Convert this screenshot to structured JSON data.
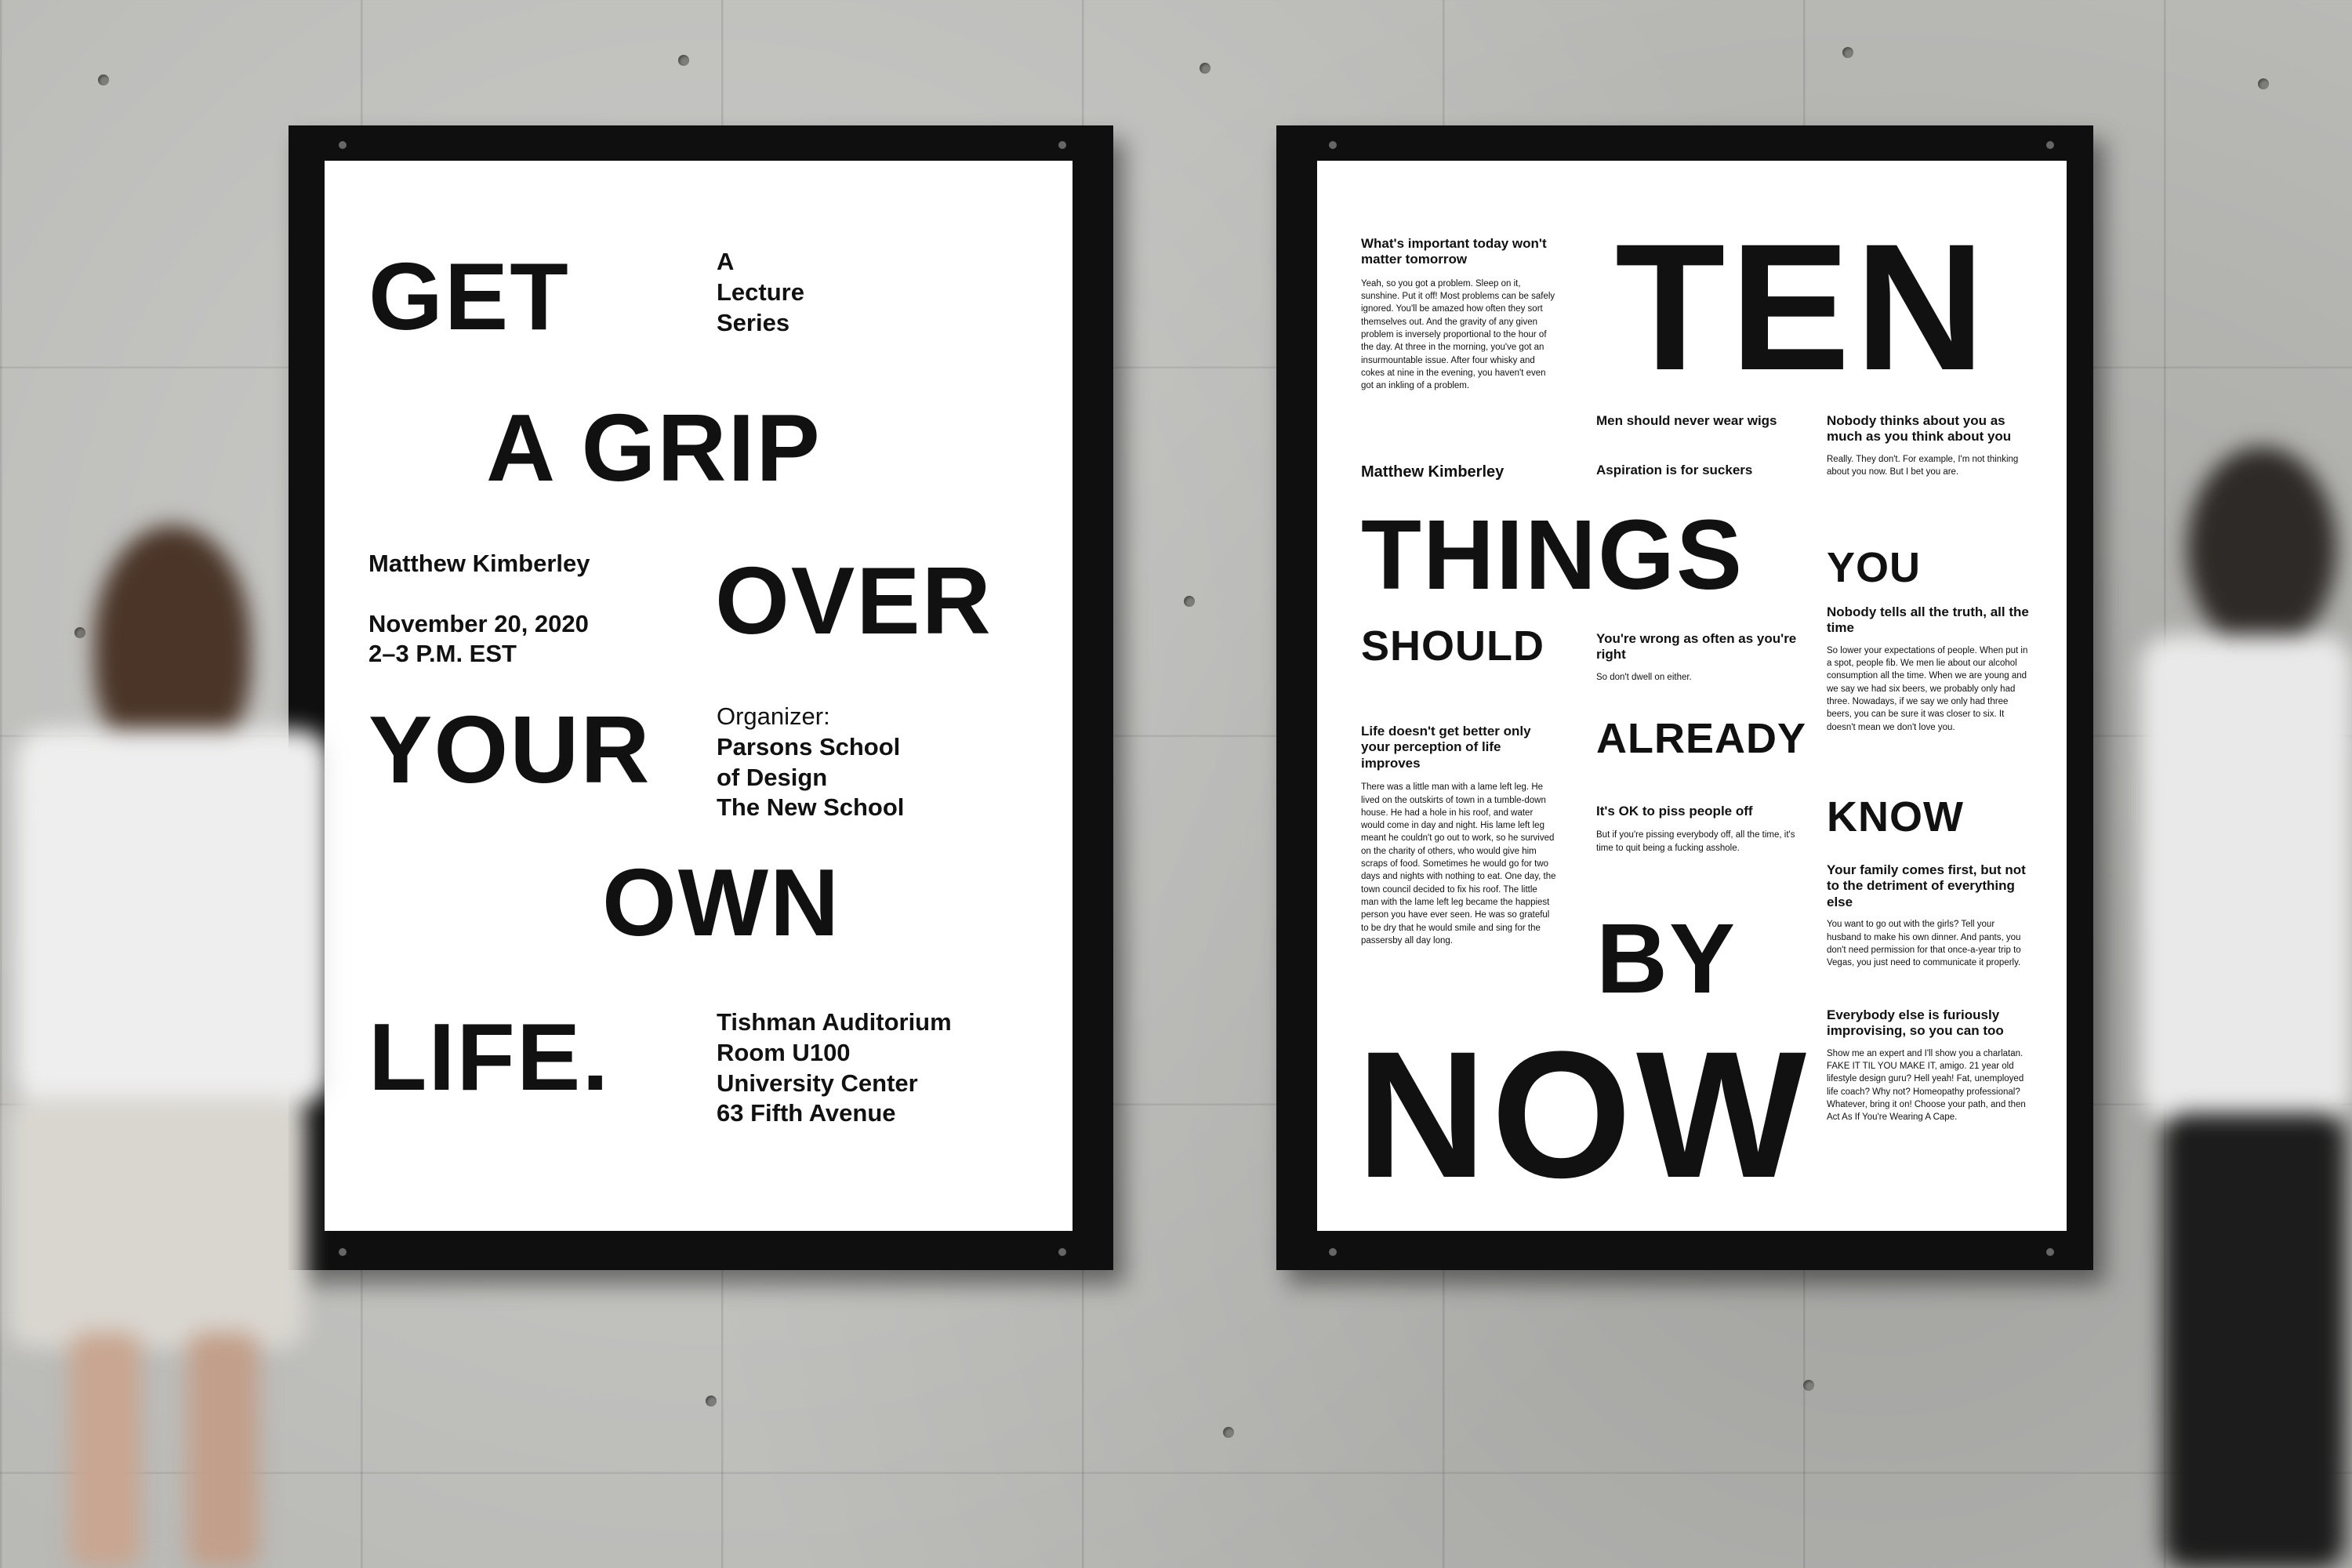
{
  "left_poster": {
    "title_lines": [
      "GET",
      "A GRIP",
      "OVER",
      "YOUR",
      "OWN",
      "LIFE."
    ],
    "series": [
      "A",
      "Lecture",
      "Series"
    ],
    "speaker": "Matthew Kimberley",
    "date": "November 20, 2020",
    "time": "2–3 P.M. EST",
    "organizer_label": "Organizer:",
    "organizer_lines": [
      "Parsons School",
      "of Design",
      "The New School"
    ],
    "venue_lines": [
      "Tishman Auditorium",
      "Room U100",
      "University Center",
      "63 Fifth Avenue"
    ]
  },
  "right_poster": {
    "title_words": [
      "TEN",
      "THINGS",
      "YOU",
      "SHOULD",
      "ALREADY",
      "KNOW",
      "BY",
      "NOW"
    ],
    "author": "Matthew Kimberley",
    "items": [
      {
        "heading": "What's important today won't matter tomorrow",
        "body": "Yeah, so you got a problem. Sleep on it, sunshine. Put it off! Most problems can be safely ignored. You'll be amazed how often they sort themselves out. And the gravity of any given problem is inversely proportional to the hour of the day. At three in the morning, you've got an insurmountable issue. After four whisky and cokes at nine in the evening, you haven't even got an inkling of a problem."
      },
      {
        "heading": "Men should never wear wigs",
        "body": ""
      },
      {
        "heading": "Aspiration is for suckers",
        "body": ""
      },
      {
        "heading": "You're wrong as often as you're right",
        "body": "So don't dwell on either."
      },
      {
        "heading": "It's OK to piss people off",
        "body": "But if you're pissing everybody off, all the time, it's time to quit being a fucking asshole."
      },
      {
        "heading": "Life doesn't get better only your perception of life improves",
        "body": "There was a little man with a lame left leg. He lived on the outskirts of town in a tumble-down house. He had a hole in his roof, and water would come in day and night. His lame left leg meant he couldn't go out to work, so he survived on the charity of others, who would give him scraps of food. Sometimes he would go for two days and nights with nothing to eat. One day, the town council decided to fix his roof. The little man with the lame left leg became the happiest person you have ever seen. He was so grateful to be dry that he would smile and sing for the passersby all day long."
      },
      {
        "heading": "Nobody thinks about you as much as you think about you",
        "body": "Really. They don't. For example, I'm not thinking about you now. But I bet you are."
      },
      {
        "heading": "Nobody tells all the truth, all the time",
        "body": "So lower your expectations of people. When put in a spot, people fib. We men lie about our alcohol consumption all the time. When we are young and we say we had six beers, we probably only had three. Nowadays, if we say we only had three beers, you can be sure it was closer to six. It doesn't mean we don't love you."
      },
      {
        "heading": "Your family comes first, but not to the detriment of everything else",
        "body": "You want to go out with the girls? Tell your husband to make his own dinner. And pants, you don't need permission for that once-a-year trip to Vegas, you just need to communicate it properly."
      },
      {
        "heading": "Everybody else is furiously improvising, so you can too",
        "body": "Show me an expert and I'll show you a charlatan. FAKE IT TIL YOU MAKE IT, amigo. 21 year old lifestyle design guru? Hell yeah! Fat, unemployed life coach? Why not? Homeopathy professional? Whatever, bring it on! Choose your path, and then Act As If You're Wearing A Cape."
      }
    ]
  }
}
